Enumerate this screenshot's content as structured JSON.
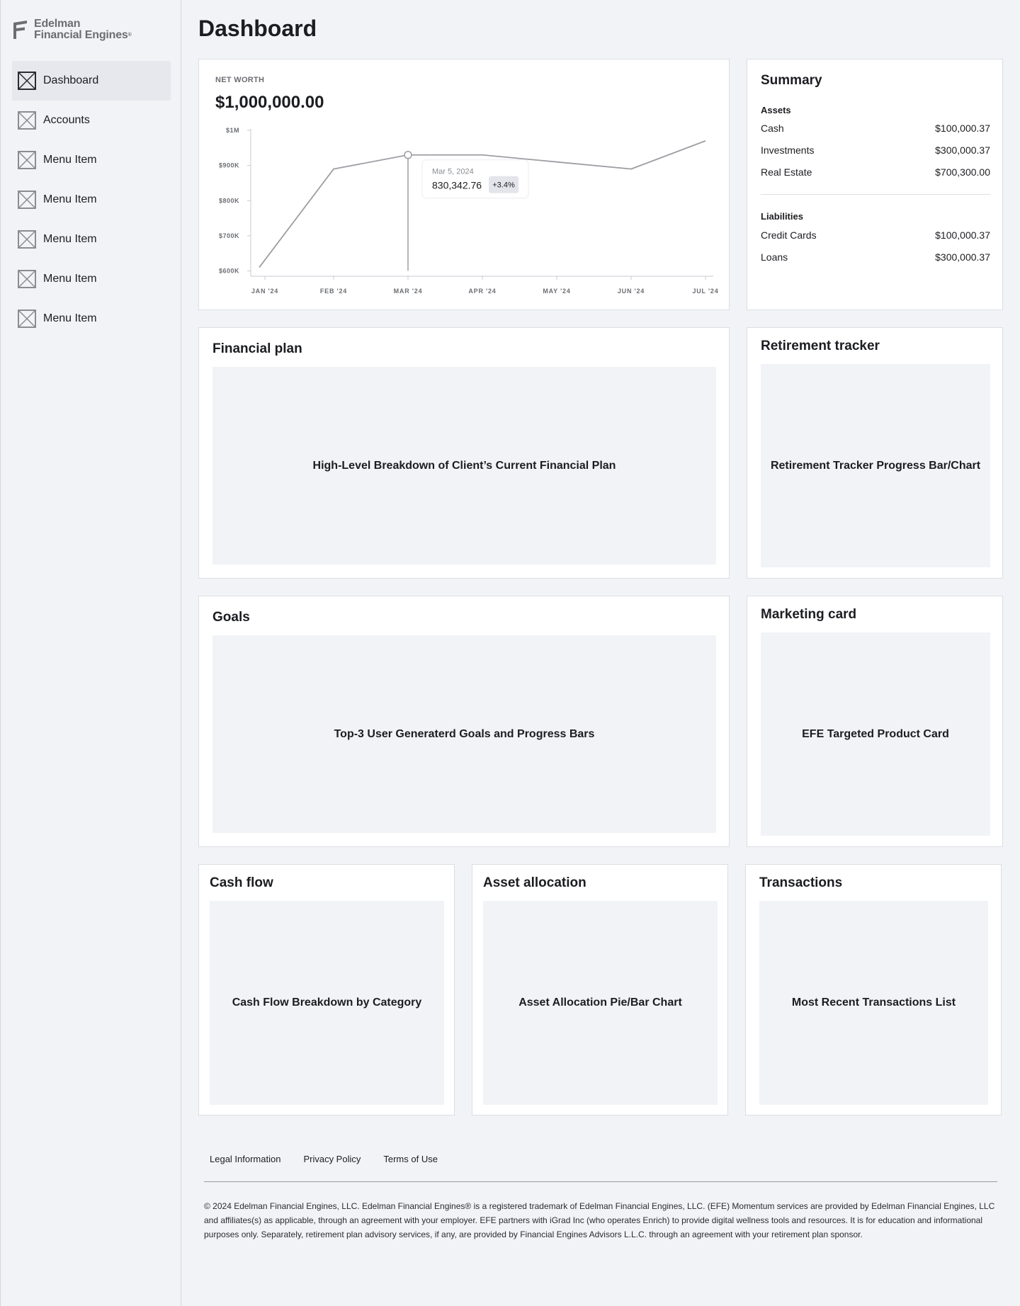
{
  "brand": {
    "line1": "Edelman",
    "line2": "Financial Engines",
    "reg": "®"
  },
  "nav": [
    {
      "label": "Dashboard",
      "active": true
    },
    {
      "label": "Accounts"
    },
    {
      "label": "Menu Item"
    },
    {
      "label": "Menu Item"
    },
    {
      "label": "Menu Item"
    },
    {
      "label": "Menu Item"
    },
    {
      "label": "Menu Item"
    }
  ],
  "page_title": "Dashboard",
  "net_worth": {
    "label": "NET WORTH",
    "value": "$1,000,000.00",
    "tooltip": {
      "date": "Mar 5, 2024",
      "value": "830,342.76",
      "change": "+3.4%"
    }
  },
  "chart_data": {
    "type": "line",
    "title": "",
    "xlabel": "",
    "ylabel": "",
    "x": [
      "JAN '24",
      "FEB '24",
      "MAR '24",
      "APR '24",
      "MAY '24",
      "JUN '24",
      "JUL '24"
    ],
    "y_ticks": [
      "$1M",
      "$900K",
      "$800K",
      "$700K",
      "$600K"
    ],
    "y_tick_values": [
      1000000,
      900000,
      800000,
      700000,
      600000
    ],
    "ylim": [
      585000,
      1000000
    ],
    "series": [
      {
        "values": [
          610000,
          890000,
          930000,
          930000,
          910000,
          890000,
          970000
        ]
      }
    ],
    "highlight_index": 2,
    "grid": false
  },
  "summary": {
    "title": "Summary",
    "assets_label": "Assets",
    "assets": [
      {
        "name": "Cash",
        "value": "$100,000.37"
      },
      {
        "name": "Investments",
        "value": "$300,000.37"
      },
      {
        "name": "Real Estate",
        "value": "$700,300.00"
      }
    ],
    "liabilities_label": "Liabilities",
    "liabilities": [
      {
        "name": "Credit Cards",
        "value": "$100,000.37"
      },
      {
        "name": "Loans",
        "value": "$300,000.37"
      }
    ]
  },
  "cards": {
    "financial_plan": {
      "title": "Financial plan",
      "body": "High-Level Breakdown of Client’s Current Financial Plan"
    },
    "retirement": {
      "title": "Retirement tracker",
      "body": "Retirement Tracker Progress Bar/Chart"
    },
    "goals": {
      "title": "Goals",
      "body": "Top-3 User Generaterd Goals and Progress Bars"
    },
    "marketing": {
      "title": "Marketing card",
      "body": "EFE Targeted Product Card"
    },
    "cash_flow": {
      "title": "Cash flow",
      "body": "Cash Flow Breakdown by Category"
    },
    "asset_allocation": {
      "title": "Asset allocation",
      "body": "Asset Allocation Pie/Bar Chart"
    },
    "transactions": {
      "title": "Transactions",
      "body": "Most Recent Transactions List"
    }
  },
  "footer": {
    "links": [
      "Legal Information",
      "Privacy Policy",
      "Terms of Use"
    ],
    "legal": "© 2024 Edelman Financial Engines, LLC. Edelman Financial Engines® is a registered trademark of Edelman Financial Engines, LLC. (EFE) Momentum services are provided by Edelman Financial Engines, LLC and affiliates(s) as applicable, through an agreement with your employer. EFE partners with iGrad Inc (who operates Enrich) to provide digital wellness tools and resources. It is for education and informational purposes only. Separately, retirement plan advisory services, if any, are provided by Financial Engines Advisors L.L.C. through an agreement with your retirement plan sponsor."
  }
}
